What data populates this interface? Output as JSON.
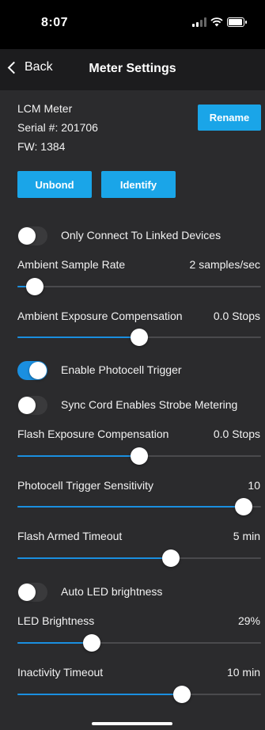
{
  "status": {
    "time": "8:07"
  },
  "nav": {
    "back_label": "Back",
    "title": "Meter Settings"
  },
  "device": {
    "name": "LCM Meter",
    "serial": "Serial #: 201706",
    "firmware": "FW: 1384",
    "rename_label": "Rename",
    "unbond_label": "Unbond",
    "identify_label": "Identify"
  },
  "colors": {
    "accent": "#1aa5e8",
    "toggle_on": "#1a8fe0",
    "background": "#2b2b2d"
  },
  "settings": {
    "only_connect": {
      "label": "Only Connect To Linked Devices",
      "on": false
    },
    "ambient_sample_rate": {
      "label": "Ambient Sample Rate",
      "value": "2 samples/sec",
      "level": 0.04
    },
    "ambient_exposure_comp": {
      "label": "Ambient Exposure Compensation",
      "value": "0.0 Stops",
      "level": 0.5
    },
    "enable_photocell": {
      "label": "Enable Photocell Trigger",
      "on": true
    },
    "sync_cord": {
      "label": "Sync Cord Enables Strobe Metering",
      "on": false
    },
    "flash_exposure_comp": {
      "label": "Flash Exposure Compensation",
      "value": "0.0 Stops",
      "level": 0.5
    },
    "photocell_sensitivity": {
      "label": "Photocell Trigger Sensitivity",
      "value": "10",
      "level": 0.96
    },
    "flash_armed_timeout": {
      "label": "Flash Armed Timeout",
      "value": "5 min",
      "level": 0.64
    },
    "auto_led": {
      "label": "Auto LED brightness",
      "on": false
    },
    "led_brightness": {
      "label": "LED Brightness",
      "value": "29%",
      "level": 0.29
    },
    "inactivity_timeout": {
      "label": "Inactivity Timeout",
      "value": "10 min",
      "level": 0.69
    }
  }
}
